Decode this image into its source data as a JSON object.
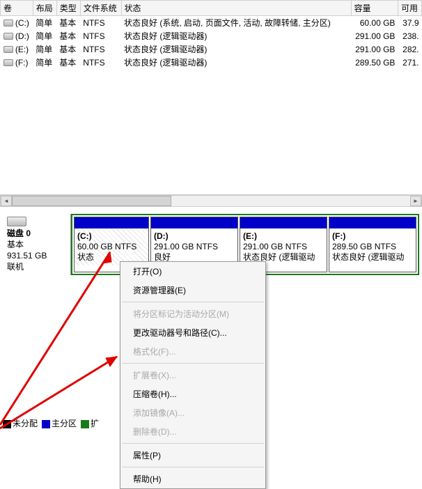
{
  "headers": {
    "volume": "卷",
    "layout": "布局",
    "type": "类型",
    "fs": "文件系统",
    "status": "状态",
    "capacity": "容量",
    "free": "可用"
  },
  "volumes": [
    {
      "drive": "(C:)",
      "layout": "简单",
      "type": "基本",
      "fs": "NTFS",
      "status": "状态良好 (系统, 启动, 页面文件, 活动, 故障转储, 主分区)",
      "capacity": "60.00 GB",
      "free": "37.9"
    },
    {
      "drive": "(D:)",
      "layout": "简单",
      "type": "基本",
      "fs": "NTFS",
      "status": "状态良好 (逻辑驱动器)",
      "capacity": "291.00 GB",
      "free": "238."
    },
    {
      "drive": "(E:)",
      "layout": "简单",
      "type": "基本",
      "fs": "NTFS",
      "status": "状态良好 (逻辑驱动器)",
      "capacity": "291.00 GB",
      "free": "282."
    },
    {
      "drive": "(F:)",
      "layout": "简单",
      "type": "基本",
      "fs": "NTFS",
      "status": "状态良好 (逻辑驱动器)",
      "capacity": "289.50 GB",
      "free": "271."
    }
  ],
  "disk": {
    "icon_label": "磁盘 0",
    "type": "基本",
    "size": "931.51 GB",
    "online": "联机"
  },
  "pv": {
    "c": {
      "label": "(C:)",
      "line": "60.00 GB NTFS",
      "status": "状态"
    },
    "d": {
      "label": "(D:)",
      "line": "291.00 GB NTFS",
      "status": "良好"
    },
    "e": {
      "label": "(E:)",
      "line": "291.00 GB NTFS",
      "status": "状态良好 (逻辑驱动"
    },
    "f": {
      "label": "(F:)",
      "line": "289.50 GB NTFS",
      "status": "状态良好 (逻辑驱动"
    }
  },
  "legend": {
    "unallocated": "未分配",
    "primary": "主分区",
    "ext": "扩"
  },
  "menu": {
    "open": "打开(O)",
    "explorer": "资源管理器(E)",
    "mark_active": "将分区标记为活动分区(M)",
    "change_letter": "更改驱动器号和路径(C)...",
    "format": "格式化(F)...",
    "extend": "扩展卷(X)...",
    "shrink": "压缩卷(H)...",
    "mirror": "添加镜像(A)...",
    "delete": "删除卷(D)...",
    "properties": "属性(P)",
    "help": "帮助(H)"
  }
}
